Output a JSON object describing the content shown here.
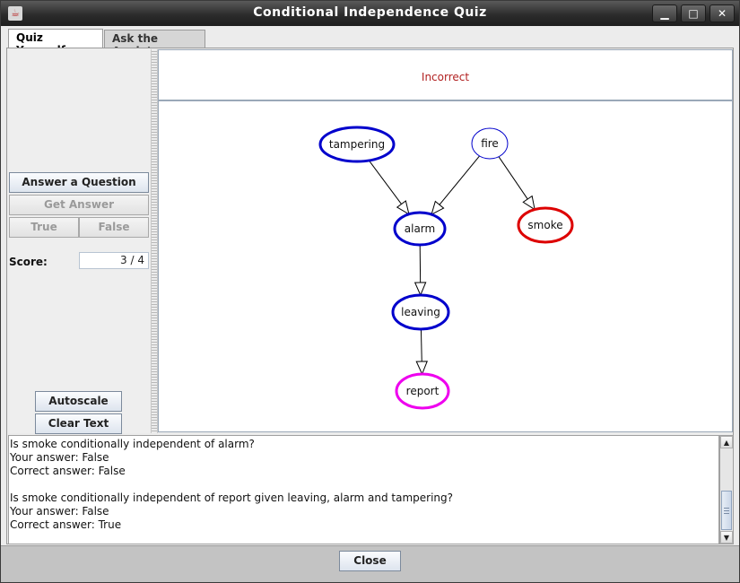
{
  "window": {
    "title": "Conditional Independence Quiz",
    "controls": {
      "minimize": "▁",
      "maximize": "□",
      "close": "✕"
    }
  },
  "tabs": [
    {
      "label": "Quiz Yourself",
      "active": true
    },
    {
      "label": "Ask the Applet",
      "active": false
    }
  ],
  "left_panel": {
    "answer_button": "Answer a Question",
    "get_answer_button": "Get Answer",
    "true_button": "True",
    "false_button": "False",
    "score_label": "Score:",
    "score_value": "3 / 4",
    "autoscale_button": "Autoscale",
    "clear_text_button": "Clear Text"
  },
  "status": {
    "text": "Incorrect",
    "color": "#b22222"
  },
  "graph": {
    "nodes": [
      {
        "id": "tampering",
        "label": "tampering",
        "style": "thick",
        "color": "#0000cc"
      },
      {
        "id": "fire",
        "label": "fire",
        "style": "thin",
        "color": "#0000cc"
      },
      {
        "id": "alarm",
        "label": "alarm",
        "style": "thick",
        "color": "#0000cc"
      },
      {
        "id": "smoke",
        "label": "smoke",
        "style": "thick",
        "color": "#dd0000"
      },
      {
        "id": "leaving",
        "label": "leaving",
        "style": "thick",
        "color": "#0000cc"
      },
      {
        "id": "report",
        "label": "report",
        "style": "thick",
        "color": "#ee00ee"
      }
    ],
    "edges": [
      {
        "from": "tampering",
        "to": "alarm"
      },
      {
        "from": "fire",
        "to": "alarm"
      },
      {
        "from": "fire",
        "to": "smoke"
      },
      {
        "from": "alarm",
        "to": "leaving"
      },
      {
        "from": "leaving",
        "to": "report"
      }
    ]
  },
  "log": [
    "Is smoke conditionally independent of alarm?",
    "Your answer: False",
    "Correct answer: False",
    "",
    "Is smoke conditionally independent of report given leaving, alarm and tampering?",
    "Your answer: False",
    "Correct answer: True"
  ],
  "bottom": {
    "close_button": "Close"
  }
}
